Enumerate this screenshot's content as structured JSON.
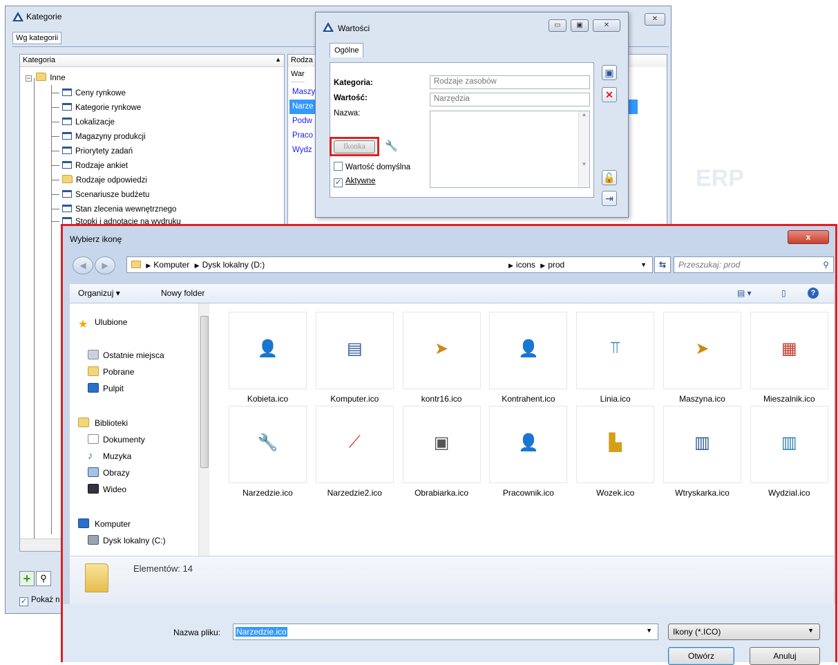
{
  "background_window": {
    "title": "Kategorie",
    "tab": "Wg kategorii",
    "tree_header": "Kategoria",
    "right_header": "Rodza",
    "right_col": "Warto",
    "right_items": [
      "Maszy",
      "Narze",
      "Podw",
      "Praco",
      "Wydz"
    ],
    "tree_root": "Inne",
    "tree_items": [
      "Ceny rynkowe",
      "Kategorie rynkowe",
      "Lokalizacje",
      "Magazyny produkcji",
      "Priorytety zadań",
      "Rodzaje ankiet",
      "Rodzaje odpowiedzi",
      "Scenariusze budżetu",
      "Stan zlecenia wewnętrznego",
      "Stopki i adnotacje na wydruku"
    ],
    "footer_check": "Pokaż n",
    "watermark": "ERP"
  },
  "values_dialog": {
    "title": "Wartości",
    "tab": "Ogólne",
    "category_label": "Kategoria:",
    "category_value": "Rodzaje zasobów",
    "value_label": "Wartość:",
    "value_value": "Narzędzia",
    "name_label": "Nazwa:",
    "icon_button": "Ikonka",
    "default_check": "Wartość domyślna",
    "active_check": "Aktywne"
  },
  "file_dialog": {
    "title": "Wybierz ikonę",
    "close": "x",
    "breadcrumb": [
      "Komputer",
      "Dysk lokalny (D:)",
      "icons",
      "prod"
    ],
    "search_placeholder": "Przeszukaj: prod",
    "organize": "Organizuj ▾",
    "new_folder": "Nowy folder",
    "nav": {
      "favorites": "Ulubione",
      "recent": "Ostatnie miejsca",
      "downloads": "Pobrane",
      "desktop": "Pulpit",
      "libraries": "Biblioteki",
      "documents": "Dokumenty",
      "music": "Muzyka",
      "pictures": "Obrazy",
      "video": "Wideo",
      "computer": "Komputer",
      "disk_c": "Dysk lokalny (C:)"
    },
    "files": [
      "Kobieta.ico",
      "Komputer.ico",
      "kontr16.ico",
      "Kontrahent.ico",
      "Linia.ico",
      "Maszyna.ico",
      "Mieszalnik.ico",
      "Narzedzie.ico",
      "Narzedzie2.ico",
      "Obrabiarka.ico",
      "Pracownik.ico",
      "Wozek.ico",
      "Wtryskarka.ico",
      "Wydzial.ico"
    ],
    "file_icons": [
      "woman-icon",
      "computer-icon",
      "contractor-icon",
      "person-icon",
      "line-icon",
      "machine-icon",
      "mixer-icon",
      "wrench-icon",
      "screwdriver-icon",
      "lathe-icon",
      "worker-icon",
      "forklift-icon",
      "injection-icon",
      "factory-icon"
    ],
    "item_count": "Elementów: 14",
    "filename_label": "Nazwa pliku:",
    "filename_value": "Narzedzie.ico",
    "filter": "Ikony (*.ICO)",
    "open": "Otwórz",
    "cancel": "Anuluj"
  },
  "colors": {
    "highlight": "#e02020",
    "selection": "#3399ff",
    "link": "#1a1aff"
  }
}
